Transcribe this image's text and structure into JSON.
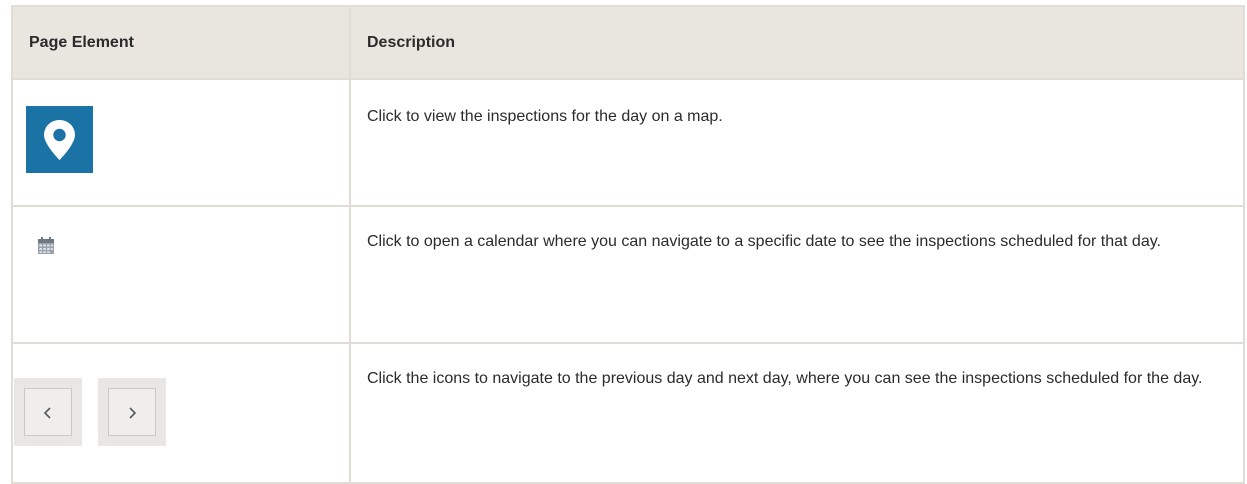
{
  "table": {
    "headers": {
      "page_element": "Page Element",
      "description": "Description"
    },
    "rows": [
      {
        "icon": "map-pin-icon",
        "description": "Click to view the inspections for the day on a map."
      },
      {
        "icon": "calendar-icon",
        "description": "Click to open a calendar where you can navigate to a specific date to see the inspections scheduled for that day."
      },
      {
        "icons": [
          "chevron-left-icon",
          "chevron-right-icon"
        ],
        "description": "Click the icons to navigate to the previous day and next day, where you can see the inspections scheduled for the day."
      }
    ]
  },
  "colors": {
    "header_background": "#e9e6e0",
    "border": "#e1ddd5",
    "map_button_background": "#1b72a4",
    "nav_button_background": "#e8e7e5"
  }
}
